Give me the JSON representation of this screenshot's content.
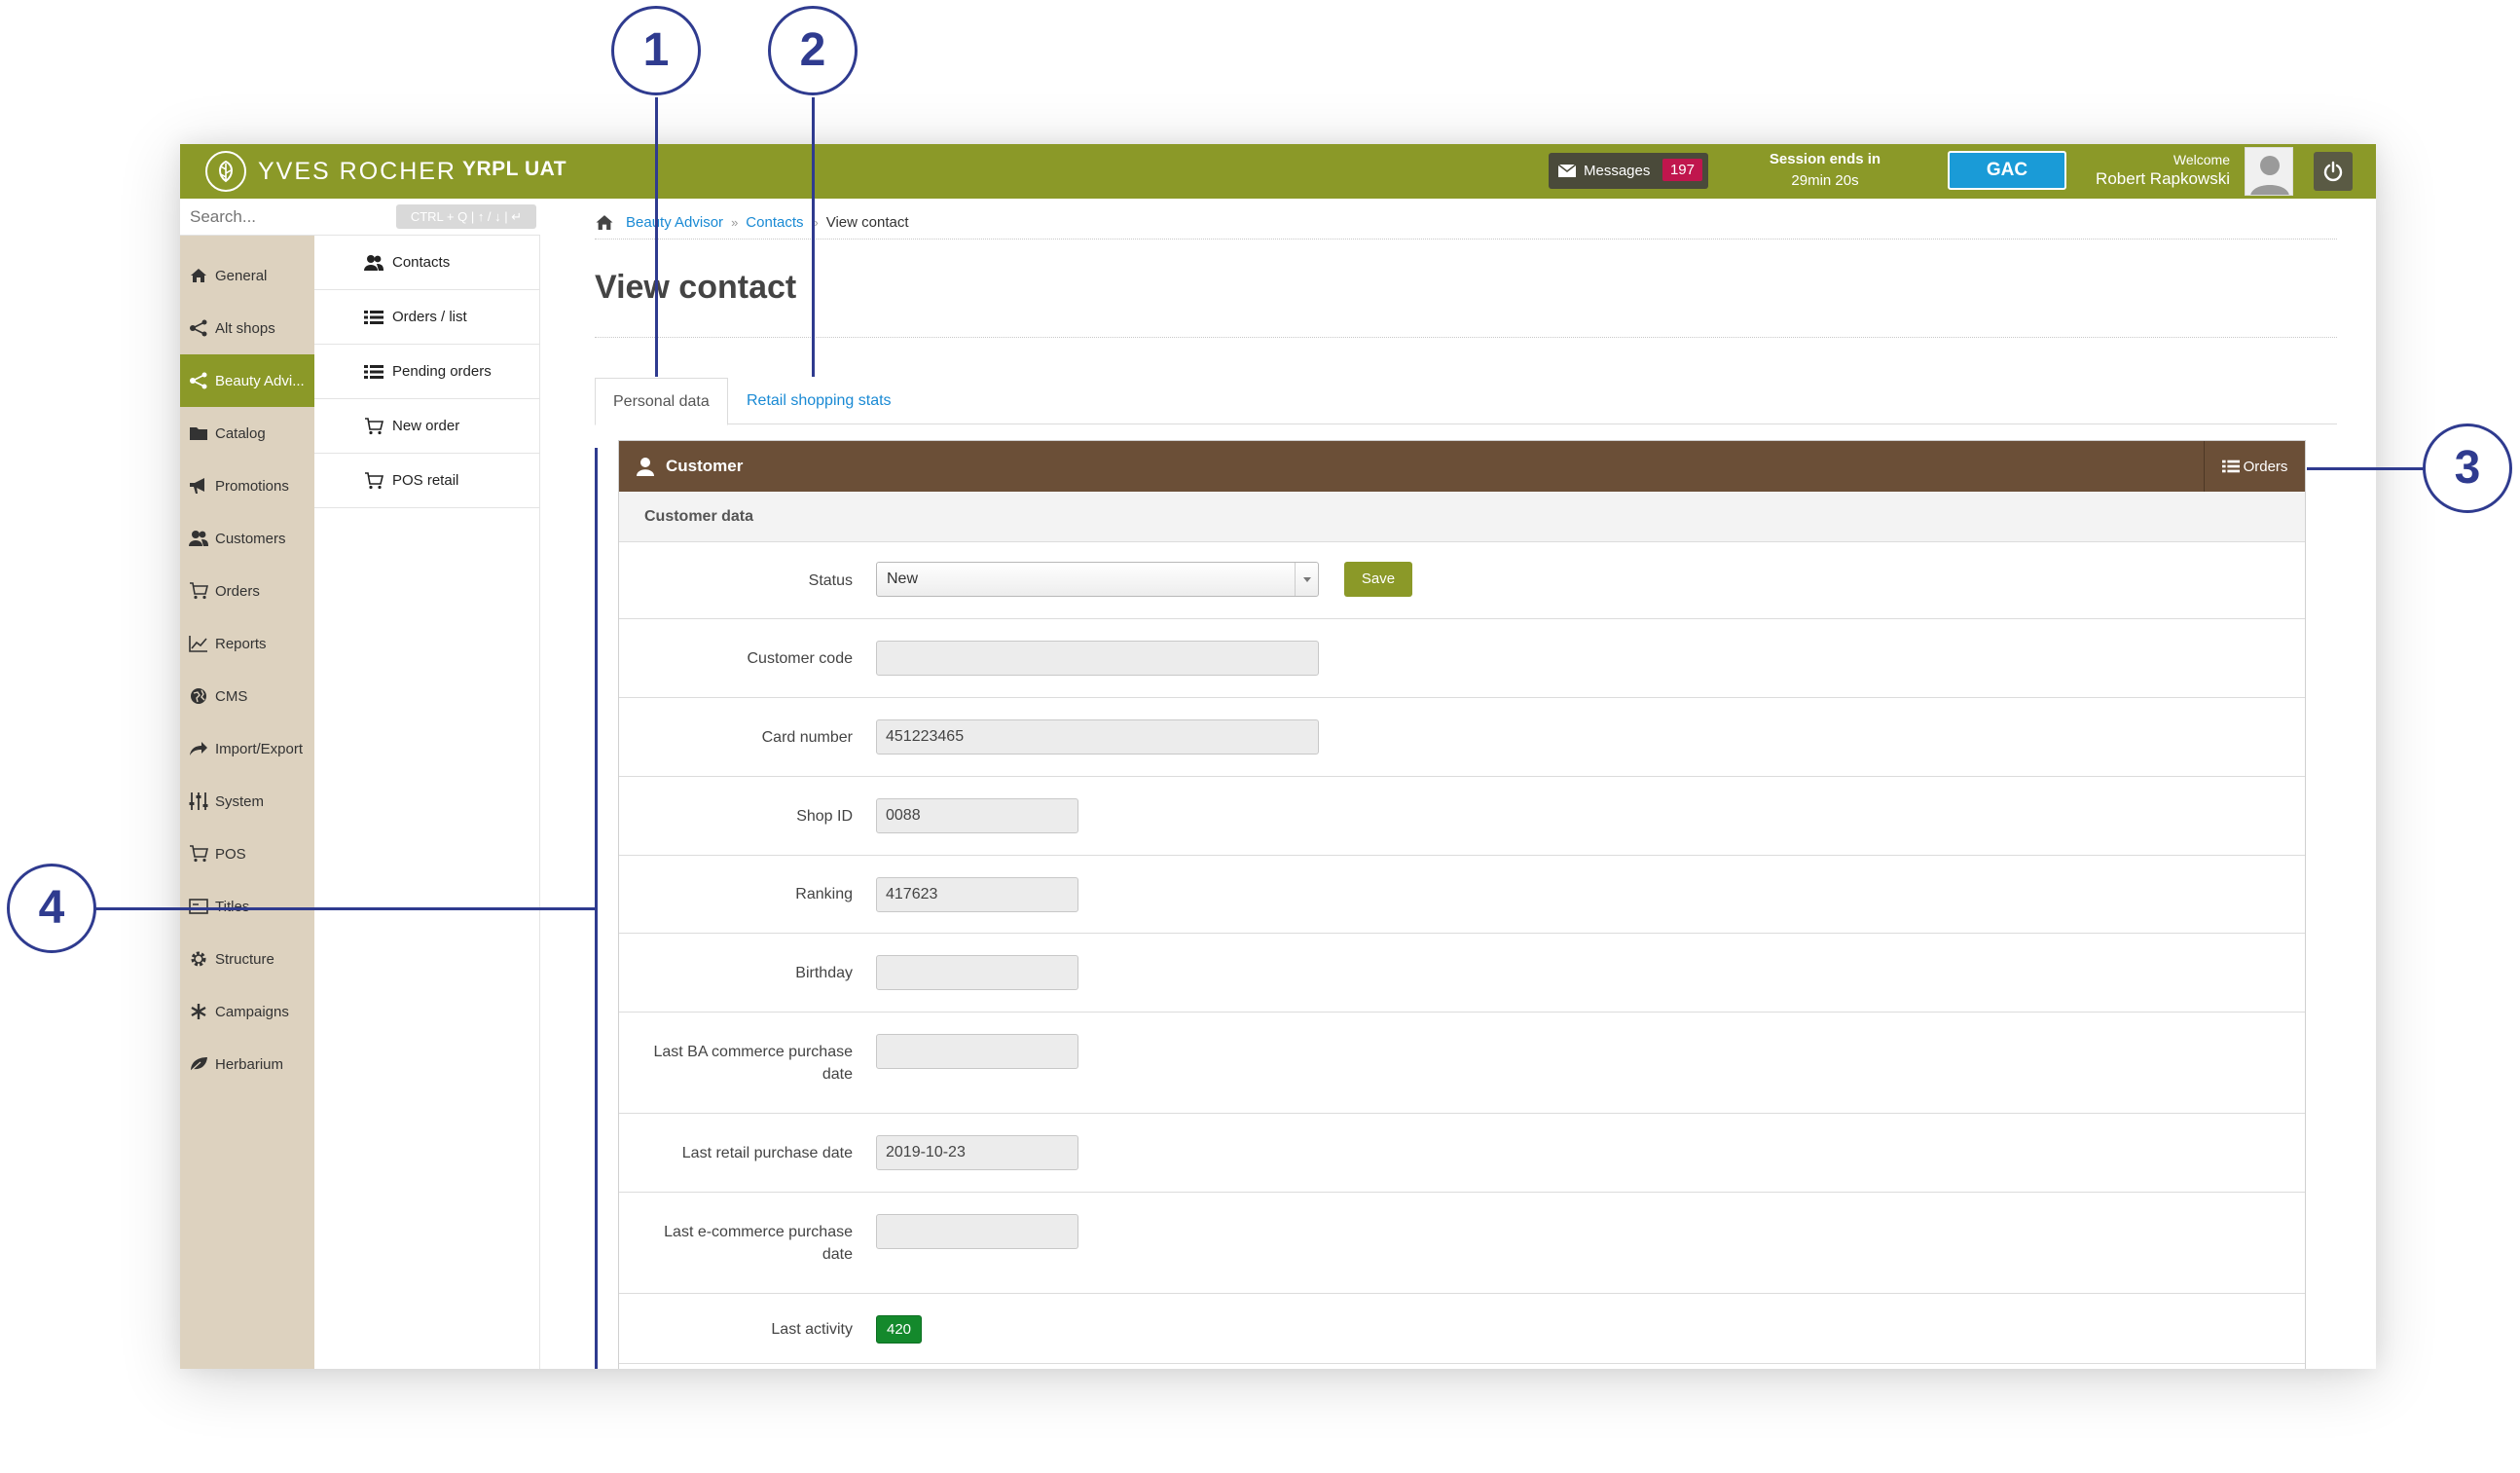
{
  "header": {
    "brand": "YVES ROCHER",
    "environment": "YRPL UAT",
    "messages_label": "Messages",
    "messages_count": "197",
    "session_line1": "Session ends in",
    "session_line2": "29min 20s",
    "gac_label": "GAC",
    "welcome_label": "Welcome",
    "user_name": "Robert Rapkowski"
  },
  "search": {
    "placeholder": "Search...",
    "shortcut_hint": "CTRL + Q  |  ↑ / ↓  |  ↵"
  },
  "rail": {
    "items": [
      {
        "label": "General",
        "icon": "home-icon"
      },
      {
        "label": "Alt shops",
        "icon": "share-icon"
      },
      {
        "label": "Beauty Advi...",
        "icon": "share-icon",
        "active": true
      },
      {
        "label": "Catalog",
        "icon": "folder-icon"
      },
      {
        "label": "Promotions",
        "icon": "megaphone-icon"
      },
      {
        "label": "Customers",
        "icon": "users-icon"
      },
      {
        "label": "Orders",
        "icon": "cart-icon"
      },
      {
        "label": "Reports",
        "icon": "chart-icon"
      },
      {
        "label": "CMS",
        "icon": "globe-icon"
      },
      {
        "label": "Import/Export",
        "icon": "arrow-icon"
      },
      {
        "label": "System",
        "icon": "sliders-icon"
      },
      {
        "label": "POS",
        "icon": "cart-icon"
      },
      {
        "label": "Titles",
        "icon": "titles-icon"
      },
      {
        "label": "Structure",
        "icon": "gear-icon"
      },
      {
        "label": "Campaigns",
        "icon": "asterisk-icon"
      },
      {
        "label": "Herbarium",
        "icon": "leaf-icon"
      }
    ]
  },
  "submenu": {
    "items": [
      {
        "label": "Contacts",
        "icon": "users-icon"
      },
      {
        "label": "Orders / list",
        "icon": "list-icon"
      },
      {
        "label": "Pending orders",
        "icon": "list-icon"
      },
      {
        "label": "New order",
        "icon": "cart-icon"
      },
      {
        "label": "POS retail",
        "icon": "cart-icon"
      }
    ]
  },
  "breadcrumb": {
    "items": [
      "Beauty Advisor",
      "Contacts"
    ],
    "current": "View contact"
  },
  "page": {
    "title": "View contact"
  },
  "tabs": [
    {
      "label": "Personal data",
      "active": true
    },
    {
      "label": "Retail shopping stats",
      "active": false
    }
  ],
  "panel": {
    "title": "Customer",
    "orders_label": "Orders",
    "section_title": "Customer data"
  },
  "form": {
    "status_label": "Status",
    "status_value": "New",
    "save_label": "Save",
    "customer_code_label": "Customer code",
    "customer_code_value": "",
    "card_number_label": "Card number",
    "card_number_value": "451223465",
    "shop_id_label": "Shop ID",
    "shop_id_value": "0088",
    "ranking_label": "Ranking",
    "ranking_value": "417623",
    "birthday_label": "Birthday",
    "birthday_value": "",
    "last_ba_label_1": "Last BA commerce purchase",
    "last_ba_label_2": "date",
    "last_ba_value": "",
    "last_retail_label": "Last retail purchase date",
    "last_retail_value": "2019-10-23",
    "last_ecom_label_1": "Last e-commerce purchase",
    "last_ecom_label_2": "date",
    "last_ecom_value": "",
    "last_activity_label": "Last activity",
    "last_activity_value": "420"
  },
  "callouts": [
    "1",
    "2",
    "3",
    "4"
  ],
  "colors": {
    "header_green": "#8b9928",
    "rail_beige": "#ddd2bf",
    "panel_brown": "#6b4f37",
    "link_blue": "#1a8ad4",
    "gac_blue": "#1a9bd7",
    "badge_red": "#c0164d",
    "activity_green": "#14892c",
    "callout_blue": "#2f3b8f"
  }
}
